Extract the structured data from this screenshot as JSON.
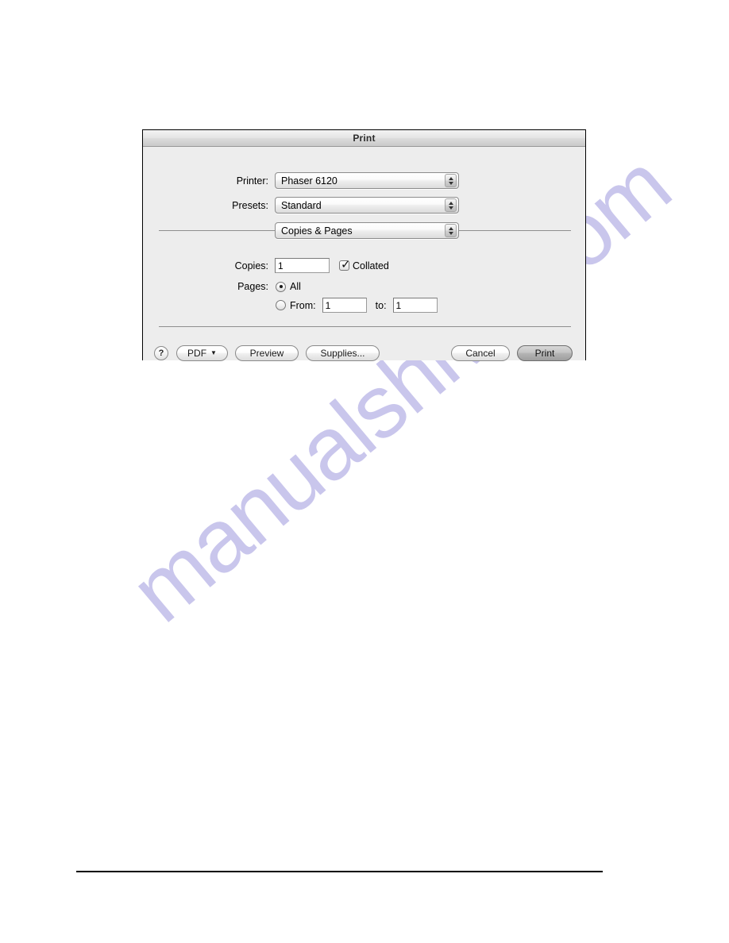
{
  "page": {
    "background_color": "#ffffff",
    "watermark_text": "manualshive.com",
    "watermark_color": "#c9c6ec"
  },
  "dialog": {
    "title": "Print",
    "printer": {
      "label": "Printer:",
      "value": "Phaser 6120",
      "stepper_up_icon": "triangle-up-icon",
      "stepper_down_icon": "triangle-down-icon"
    },
    "presets": {
      "label": "Presets:",
      "value": "Standard"
    },
    "pane": {
      "value": "Copies & Pages"
    },
    "copies": {
      "label": "Copies:",
      "value": "1",
      "collated_label": "Collated",
      "collated_checked": true,
      "check_icon": "check-icon"
    },
    "pages": {
      "label": "Pages:",
      "all_label": "All",
      "all_selected": true,
      "from_label": "From:",
      "from_value": "1",
      "to_label": "to:",
      "to_value": "1",
      "range_selected": false
    },
    "buttons": {
      "help": "?",
      "pdf": "PDF",
      "pdf_caret_icon": "caret-down-icon",
      "preview": "Preview",
      "supplies": "Supplies...",
      "cancel": "Cancel",
      "print": "Print"
    }
  }
}
